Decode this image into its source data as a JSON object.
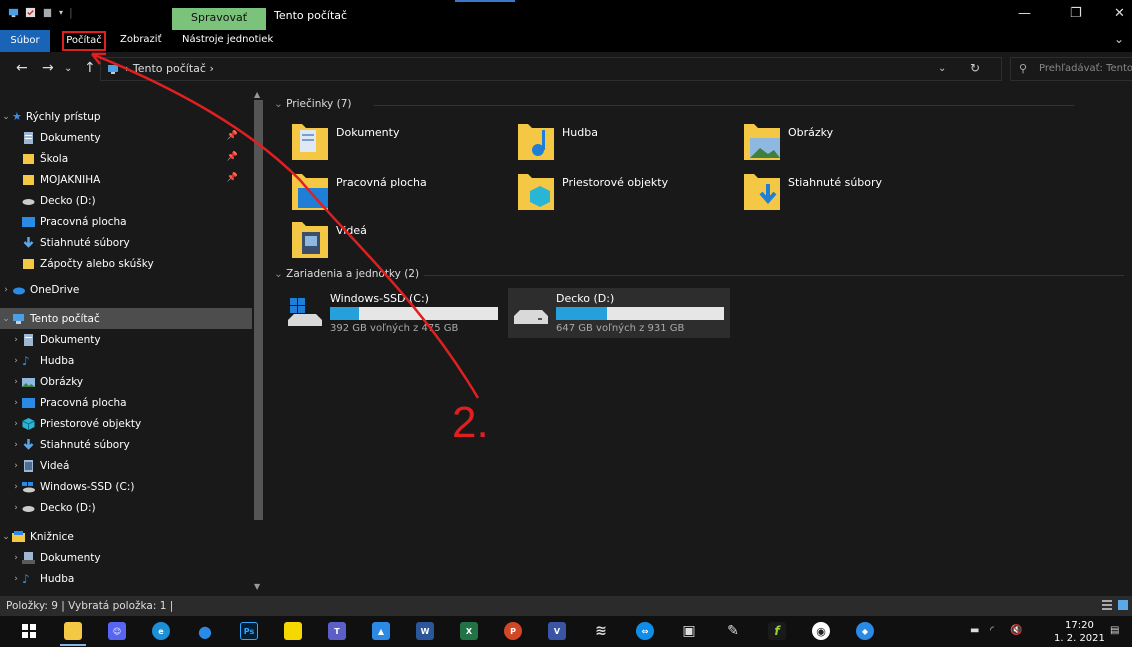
{
  "window": {
    "manage_tab": "Spravovať",
    "title": "Tento počítač"
  },
  "ribbon": {
    "tabs": [
      "Súbor",
      "Počítač",
      "Zobraziť",
      "Nástroje jednotiek"
    ]
  },
  "address": {
    "breadcrumb": "Tento počítač",
    "search_placeholder": "Prehľadávať: Tento..."
  },
  "sidebar": {
    "quick_access": "Rýchly prístup",
    "quick_items": [
      "Dokumenty",
      "Škola",
      "MOJAKNIHA",
      "Decko (D:)",
      "Pracovná plocha",
      "Stiahnuté súbory",
      "Zápočty alebo skúšky"
    ],
    "onedrive": "OneDrive",
    "this_pc": "Tento počítač",
    "pc_items": [
      "Dokumenty",
      "Hudba",
      "Obrázky",
      "Pracovná plocha",
      "Priestorové objekty",
      "Stiahnuté súbory",
      "Videá",
      "Windows-SSD (C:)",
      "Decko (D:)"
    ],
    "libraries": "Knižnice",
    "lib_items": [
      "Dokumenty",
      "Hudba"
    ]
  },
  "content": {
    "folders_header": "Priečinky (7)",
    "folders": [
      "Dokumenty",
      "Hudba",
      "Obrázky",
      "Pracovná plocha",
      "Priestorové objekty",
      "Stiahnuté súbory",
      "Videá"
    ],
    "drives_header": "Zariadenia a jednotky (2)",
    "drives": [
      {
        "name": "Windows-SSD (C:)",
        "free": "392 GB voľných z 475 GB",
        "used_fraction": 0.175
      },
      {
        "name": "Decko (D:)",
        "free": "647 GB voľných z 931 GB",
        "used_fraction": 0.305
      }
    ]
  },
  "status": {
    "text": "Položky: 9  |  Vybratá položka: 1  |"
  },
  "taskbar": {
    "time": "17:20",
    "date": "1. 2. 2021",
    "apps": [
      "start",
      "file-explorer",
      "discord",
      "edge",
      "drop",
      "Ps",
      "sticky",
      "teams",
      "photos",
      "W",
      "X",
      "P",
      "V",
      "layers",
      "teamviewer",
      "store",
      "paint",
      "f",
      "media",
      "extra"
    ]
  },
  "annotation": {
    "label": "2.",
    "color": "#e02020"
  },
  "colors": {
    "accent": "#1a64b8",
    "manage": "#7bc27b",
    "drive_bar": "#26a0da",
    "folder_yellow": "#f4c745"
  }
}
